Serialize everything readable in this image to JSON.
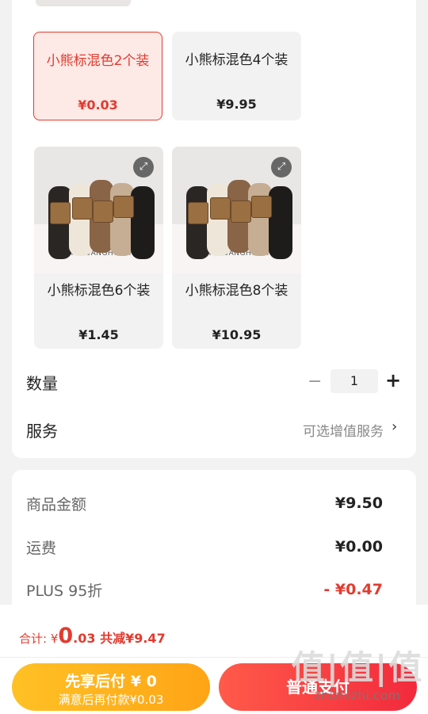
{
  "variants": [
    {
      "name": "小熊标混色2个装",
      "price": "¥0.03",
      "selected": true
    },
    {
      "name": "小熊标混色4个装",
      "price": "¥9.95",
      "selected": false
    },
    {
      "name": "小熊标混色6个装",
      "price": "¥1.45",
      "selected": false
    },
    {
      "name": "小熊标混色8个装",
      "price": "¥10.95",
      "selected": false
    }
  ],
  "product_image": {
    "brand_text": "SHIGUANGHUALI"
  },
  "quantity": {
    "label": "数量",
    "minus": "−",
    "value": "1",
    "plus": "+"
  },
  "service": {
    "label": "服务",
    "hint": "可选增值服务",
    "chevron": "›"
  },
  "summary": {
    "rows": [
      {
        "label": "商品金额",
        "value": "¥9.50"
      },
      {
        "label": "运费",
        "value": "¥0.00"
      },
      {
        "label": "PLUS 95折",
        "value": "- ¥0.47"
      }
    ]
  },
  "footer": {
    "total_prefix": "合计: ¥",
    "total_amount": "0",
    "total_decimal": ".03",
    "discount_text": " 共减¥9.47",
    "pay_later_title": "先享后付 ¥ 0",
    "pay_later_sub": "满意后再付款¥0.03",
    "pay_now": "普通支付"
  },
  "watermark": {
    "logo": "值|值|值",
    "text": "zhizhizhi.com"
  },
  "colors": {
    "accent": "#e23b2f",
    "pay_later": "#ffb21c",
    "pay_now": "#f22a3c"
  }
}
